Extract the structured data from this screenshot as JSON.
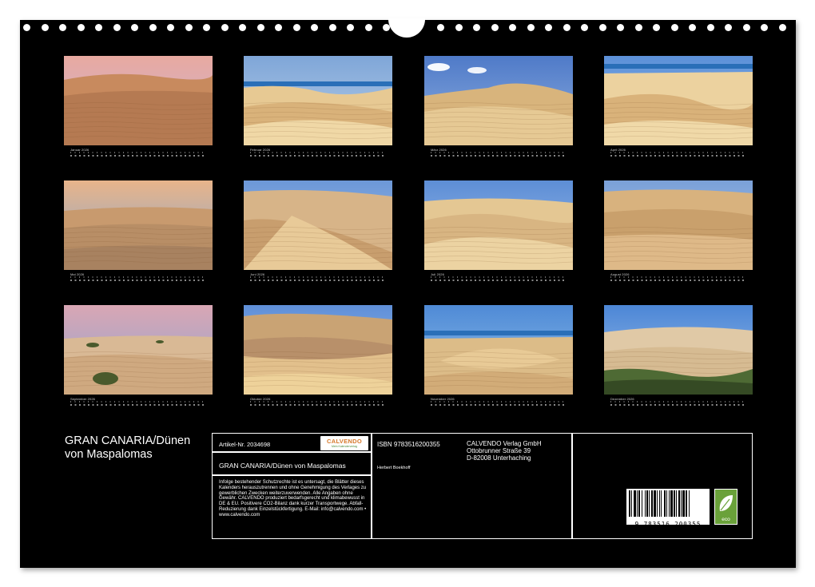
{
  "months": [
    {
      "label": "Januar 2026",
      "scene": "sunset"
    },
    {
      "label": "Februar 2026",
      "scene": "sea"
    },
    {
      "label": "März 2026",
      "scene": "cloud"
    },
    {
      "label": "April 2026",
      "scene": "sea2"
    },
    {
      "label": "Mai 2026",
      "scene": "dusk"
    },
    {
      "label": "Juni 2026",
      "scene": "ridge"
    },
    {
      "label": "Juli 2026",
      "scene": "plain"
    },
    {
      "label": "August 2026",
      "scene": "flat"
    },
    {
      "label": "September 2026",
      "scene": "bush"
    },
    {
      "label": "Oktober 2026",
      "scene": "layers"
    },
    {
      "label": "November 2026",
      "scene": "bowl"
    },
    {
      "label": "Dezember 2026",
      "scene": "green"
    }
  ],
  "title_line1": "GRAN CANARIA/Dünen",
  "title_line2": "von Maspalomas",
  "article_number": "Artikel-Nr. 2034698",
  "logo_text": "CALVENDO",
  "logo_tagline": "Mein Kalenderverlag",
  "book_title": "GRAN CANARIA/Dünen von Maspalomas",
  "legal_text": "Infolge bestehender Schutzrechte ist es untersagt, die Blätter dieses Kalenders herauszutrennen und ohne Genehmigung des Verlages zu gewerblichen Zwecken weiterzuverwenden. Alle Angaben ohne Gewähr. CALVENDO produziert bedarfsgerecht und klimabewusst in DE & EU. Positivere CO2-Bilanz dank kurzer Transportwege. Abfall-Reduzierung dank Einzelstückfertigung. E-Mail: info@calvendo.com • www.calvendo.com",
  "isbn": "ISBN 9783516200355",
  "author": "Herbert Boekhoff",
  "publisher_name": "CALVENDO Verlag GmbH",
  "publisher_street": "Ottobrunner Straße 39",
  "publisher_city": "D-82008 Unterhaching",
  "barcode_number": "9 783516 200355",
  "eco_label": "eco",
  "colors": {
    "sheet": "#000000",
    "sand": "#e2c48e",
    "sky": "#5c8ad0",
    "eco": "#6aa13a"
  }
}
